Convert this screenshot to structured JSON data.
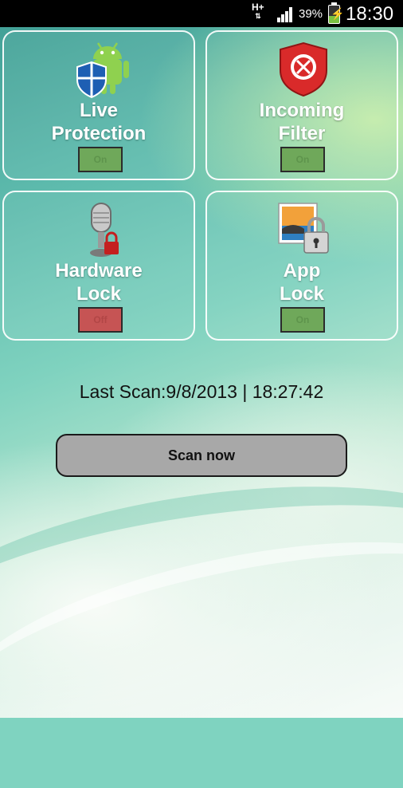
{
  "status_bar": {
    "network": "H+",
    "battery_percent": "39%",
    "time": "18:30"
  },
  "tiles": [
    {
      "title_line1": "Live",
      "title_line2": "Protection",
      "toggle": "On",
      "state": "on",
      "icon": "android-shield-icon"
    },
    {
      "title_line1": "Incoming",
      "title_line2": "Filter",
      "toggle": "On",
      "state": "on",
      "icon": "blocked-call-shield-icon"
    },
    {
      "title_line1": "Hardware",
      "title_line2": "Lock",
      "toggle": "Off",
      "state": "off",
      "icon": "microphone-lock-icon"
    },
    {
      "title_line1": "App",
      "title_line2": "Lock",
      "toggle": "On",
      "state": "on",
      "icon": "picture-lock-icon"
    }
  ],
  "last_scan": "Last Scan:9/8/2013 | 18:27:42",
  "scan_button": "Scan now"
}
